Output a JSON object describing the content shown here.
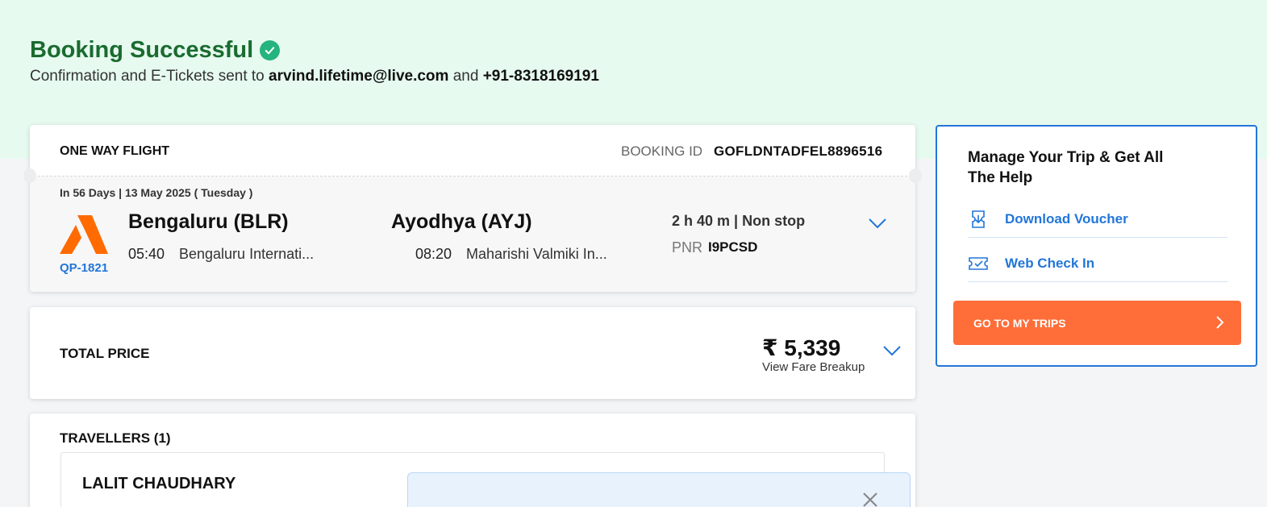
{
  "header": {
    "title": "Booking Successful",
    "subtitle_prefix": "Confirmation and E-Tickets sent to",
    "email": "arvind.lifetime@live.com",
    "conjunction": "and",
    "phone": "+91-8318169191"
  },
  "flight": {
    "trip_type": "ONE WAY FLIGHT",
    "booking_id_label": "BOOKING ID",
    "booking_id": "GOFLDNTADFEL8896516",
    "date_line": "In 56 Days | 13 May 2025 ( Tuesday )",
    "airline_code": "QP-1821",
    "origin": {
      "city": "Bengaluru (BLR)",
      "time": "05:40",
      "airport": "Bengaluru Internati..."
    },
    "destination": {
      "city": "Ayodhya (AYJ)",
      "time": "08:20",
      "airport": "Maharishi Valmiki In..."
    },
    "duration": "2 h 40 m | Non stop",
    "pnr_label": "PNR",
    "pnr": "I9PCSD"
  },
  "price": {
    "label": "TOTAL PRICE",
    "amount": "₹ 5,339",
    "fare_link": "View Fare Breakup"
  },
  "travellers": {
    "title": "TRAVELLERS (1)",
    "items": [
      {
        "name": "LALIT CHAUDHARY"
      }
    ]
  },
  "sidebar": {
    "title": "Manage Your Trip & Get All The Help",
    "links": [
      {
        "label": "Download Voucher",
        "icon": "voucher-icon"
      },
      {
        "label": "Web Check In",
        "icon": "ticket-icon"
      }
    ],
    "cta": "GO TO MY TRIPS"
  },
  "colors": {
    "success_green": "#1a6b2f",
    "accent_blue": "#2276d8",
    "cta_orange": "#ff6d38",
    "hero_bg": "#e6faf0",
    "airline_orange": "#ff6b00"
  }
}
